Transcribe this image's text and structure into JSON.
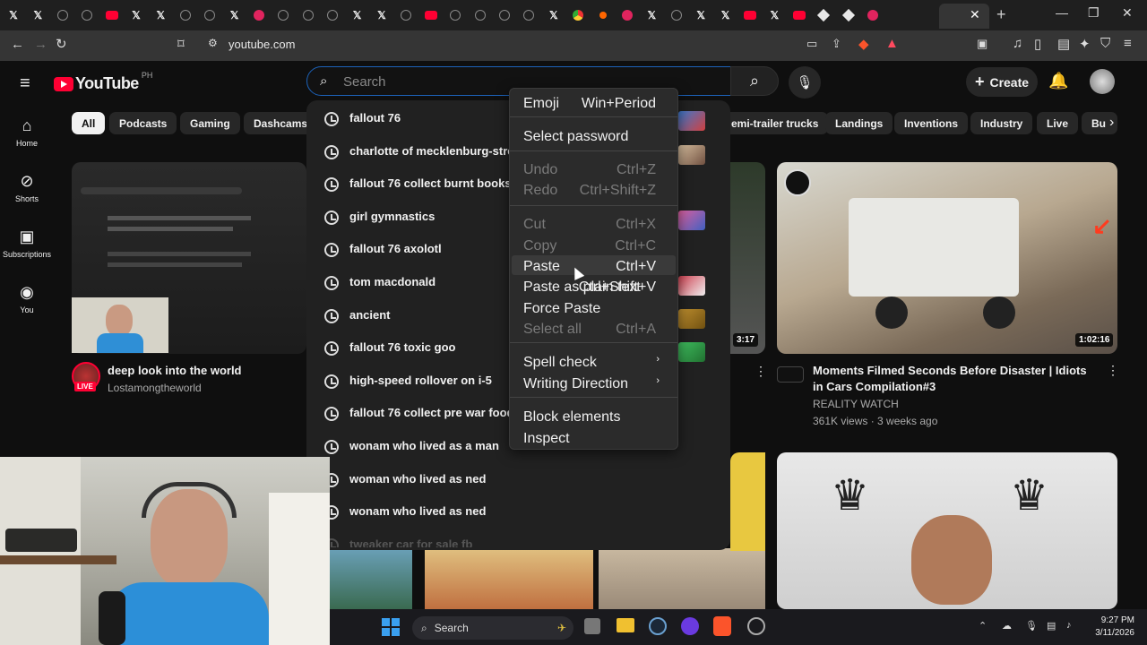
{
  "browser": {
    "url": "youtube.com",
    "tabs": [
      "x",
      "x",
      "circle",
      "circle",
      "yt",
      "x",
      "x",
      "circle",
      "circle",
      "x",
      "pink",
      "circle",
      "circle",
      "circle",
      "x",
      "x",
      "circle",
      "yt",
      "circle",
      "circle",
      "circle",
      "circle",
      "x",
      "chrome",
      "dots",
      "pink",
      "x",
      "circle",
      "x",
      "x",
      "yt",
      "x",
      "yt",
      "diamond",
      "diamond",
      "pink"
    ]
  },
  "youtube": {
    "logo_text": "YouTube",
    "country": "PH",
    "search_placeholder": "Search",
    "create_label": "Create",
    "sidebar": [
      {
        "label": "Home",
        "icon": "home-icon"
      },
      {
        "label": "Shorts",
        "icon": "shorts-icon"
      },
      {
        "label": "Subscriptions",
        "icon": "subscriptions-icon"
      },
      {
        "label": "You",
        "icon": "you-icon"
      }
    ],
    "chips": [
      "All",
      "Podcasts",
      "Gaming",
      "Dashcams",
      "emi-trailer trucks",
      "Landings",
      "Inventions",
      "Industry",
      "Live",
      "Bu"
    ],
    "videos": [
      {
        "title": "deep look into the world",
        "channel": "Lostamongtheworld",
        "badge": "LIVE",
        "duration": ""
      },
      {
        "title": "",
        "channel": "",
        "badge": "",
        "duration": "3:17"
      },
      {
        "title": "Moments Filmed Seconds Before Disaster | Idiots in Cars Compilation#3",
        "channel": "REALITY WATCH",
        "meta": "361K views · 3 weeks ago",
        "duration": "1:02:16"
      }
    ]
  },
  "suggestions": [
    "fallout 76",
    "charlotte of mecklenburg-stre",
    "fallout 76 collect burnt books",
    "girl gymnastics",
    "fallout 76 axolotl",
    "tom macdonald",
    "ancient",
    "fallout 76 toxic goo",
    "high-speed rollover on i-5",
    "fallout 76 collect pre war food",
    "wonam who lived as a man",
    "woman who lived as ned",
    "wonam who lived as ned",
    "tweaker car for sale fb"
  ],
  "context_menu": {
    "items": [
      {
        "label": "Emoji",
        "shortcut": "Win+Period",
        "disabled": false
      },
      {
        "label": "Select password",
        "shortcut": "",
        "disabled": false
      },
      {
        "label": "Undo",
        "shortcut": "Ctrl+Z",
        "disabled": true
      },
      {
        "label": "Redo",
        "shortcut": "Ctrl+Shift+Z",
        "disabled": true
      },
      {
        "label": "Cut",
        "shortcut": "Ctrl+X",
        "disabled": true
      },
      {
        "label": "Copy",
        "shortcut": "Ctrl+C",
        "disabled": true
      },
      {
        "label": "Paste",
        "shortcut": "Ctrl+V",
        "disabled": false
      },
      {
        "label": "Paste as plain text",
        "shortcut": "Ctrl+Shift+V",
        "disabled": false
      },
      {
        "label": "Force Paste",
        "shortcut": "",
        "disabled": false
      },
      {
        "label": "Select all",
        "shortcut": "Ctrl+A",
        "disabled": true
      },
      {
        "label": "Spell check",
        "shortcut": "",
        "disabled": false,
        "submenu": true
      },
      {
        "label": "Writing Direction",
        "shortcut": "",
        "disabled": false,
        "submenu": true
      },
      {
        "label": "Block elements",
        "shortcut": "",
        "disabled": false
      },
      {
        "label": "Inspect",
        "shortcut": "",
        "disabled": false
      }
    ]
  },
  "taskbar": {
    "search_label": "Search",
    "time": "9:27 PM",
    "date": "3/11/2026"
  },
  "colors": {
    "accent_red": "#ff0033",
    "bg": "#0f0f0f",
    "menu_bg": "#2b2b2b",
    "dropdown_bg": "#212121"
  }
}
